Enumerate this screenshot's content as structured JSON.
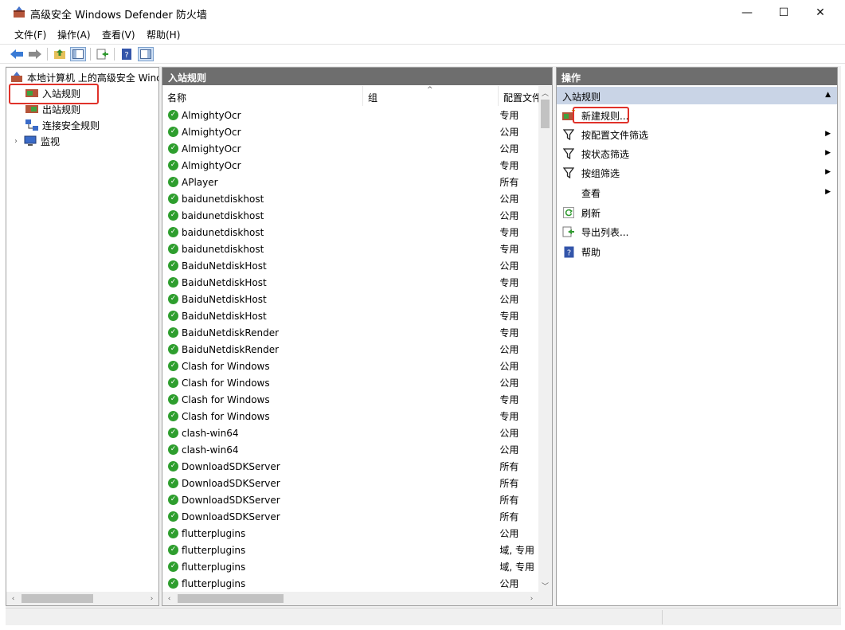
{
  "window": {
    "title": "高级安全 Windows Defender 防火墙",
    "icon": "firewall-icon",
    "controls": {
      "minimize": "—",
      "maximize": "☐",
      "close": "✕"
    }
  },
  "menu": [
    "文件(F)",
    "操作(A)",
    "查看(V)",
    "帮助(H)"
  ],
  "toolbar": [
    "back-arrow-icon",
    "forward-arrow-icon",
    "up-folder-icon",
    "show-hide-tree-icon",
    "export-icon",
    "help-icon",
    "show-hide-action-pane-icon"
  ],
  "tree": {
    "root": "本地计算机 上的高级安全 Windows Defender 防火墙",
    "items": [
      {
        "label": "入站规则",
        "icon": "inbound-rules-icon",
        "selected": true
      },
      {
        "label": "出站规则",
        "icon": "outbound-rules-icon"
      },
      {
        "label": "连接安全规则",
        "icon": "connection-security-icon"
      },
      {
        "label": "监视",
        "icon": "monitor-icon",
        "expandable": true
      }
    ]
  },
  "center": {
    "title": "入站规则",
    "columns": [
      "名称",
      "组",
      "配置文件"
    ],
    "rows": [
      {
        "name": "AlmightyOcr",
        "profile": "专用"
      },
      {
        "name": "AlmightyOcr",
        "profile": "公用"
      },
      {
        "name": "AlmightyOcr",
        "profile": "公用"
      },
      {
        "name": "AlmightyOcr",
        "profile": "专用"
      },
      {
        "name": "APlayer",
        "profile": "所有"
      },
      {
        "name": "baidunetdiskhost",
        "profile": "公用"
      },
      {
        "name": "baidunetdiskhost",
        "profile": "公用"
      },
      {
        "name": "baidunetdiskhost",
        "profile": "专用"
      },
      {
        "name": "baidunetdiskhost",
        "profile": "专用"
      },
      {
        "name": "BaiduNetdiskHost",
        "profile": "公用"
      },
      {
        "name": "BaiduNetdiskHost",
        "profile": "专用"
      },
      {
        "name": "BaiduNetdiskHost",
        "profile": "公用"
      },
      {
        "name": "BaiduNetdiskHost",
        "profile": "专用"
      },
      {
        "name": "BaiduNetdiskRender",
        "profile": "专用"
      },
      {
        "name": "BaiduNetdiskRender",
        "profile": "公用"
      },
      {
        "name": "Clash for Windows",
        "profile": "公用"
      },
      {
        "name": "Clash for Windows",
        "profile": "公用"
      },
      {
        "name": "Clash for Windows",
        "profile": "专用"
      },
      {
        "name": "Clash for Windows",
        "profile": "专用"
      },
      {
        "name": "clash-win64",
        "profile": "公用"
      },
      {
        "name": "clash-win64",
        "profile": "公用"
      },
      {
        "name": "DownloadSDKServer",
        "profile": "所有"
      },
      {
        "name": "DownloadSDKServer",
        "profile": "所有"
      },
      {
        "name": "DownloadSDKServer",
        "profile": "所有"
      },
      {
        "name": "DownloadSDKServer",
        "profile": "所有"
      },
      {
        "name": "flutterplugins",
        "profile": "公用"
      },
      {
        "name": "flutterplugins",
        "profile": "域, 专用"
      },
      {
        "name": "flutterplugins",
        "profile": "域, 专用"
      },
      {
        "name": "flutterplugins",
        "profile": "公用"
      }
    ]
  },
  "actions": {
    "title": "操作",
    "section": "入站规则",
    "items": [
      {
        "label": "新建规则...",
        "icon": "new-rule-icon",
        "highlighted": true
      },
      {
        "label": "按配置文件筛选",
        "icon": "filter-icon",
        "submenu": true
      },
      {
        "label": "按状态筛选",
        "icon": "filter-icon",
        "submenu": true
      },
      {
        "label": "按组筛选",
        "icon": "filter-icon",
        "submenu": true
      },
      {
        "label": "查看",
        "icon": "",
        "submenu": true
      },
      {
        "label": "刷新",
        "icon": "refresh-icon"
      },
      {
        "label": "导出列表...",
        "icon": "export-list-icon"
      },
      {
        "label": "帮助",
        "icon": "help-icon"
      }
    ]
  },
  "colors": {
    "header_bg": "#6e6e6e",
    "section_bg": "#c9d4e6",
    "highlight": "#e0322a",
    "check_green": "#2e9e2e"
  }
}
